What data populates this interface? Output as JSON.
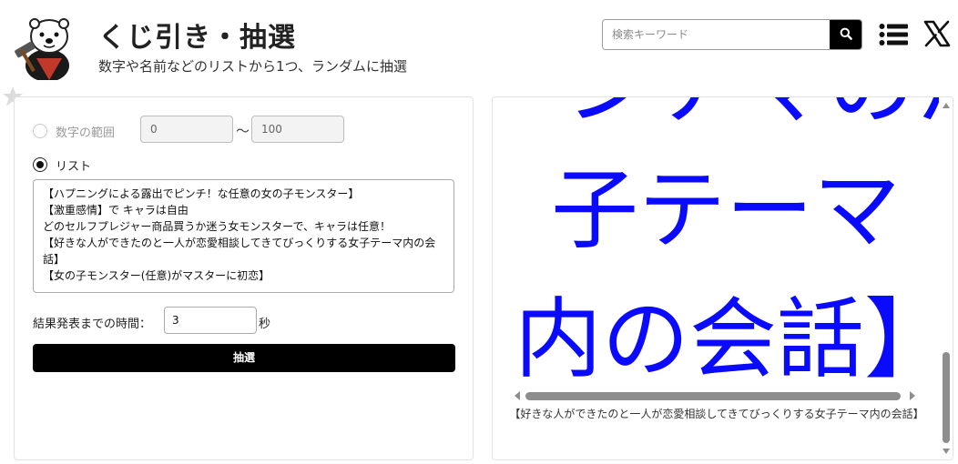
{
  "header": {
    "title": "くじ引き・抽選",
    "subtitle": "数字や名前などのリストから1つ、ランダムに抽選",
    "search": {
      "placeholder": "検索キーワード",
      "value": ""
    }
  },
  "form": {
    "range_option": {
      "label": "数字の範囲",
      "min_placeholder": "0",
      "tilde": "〜",
      "max_placeholder": "100",
      "selected": false,
      "disabled": true
    },
    "list_option": {
      "label": "リスト",
      "selected": true
    },
    "list_lines": [
      "【ハプニングによる露出でピンチ！な任意の女の子モンスター】",
      "【激重感情】で キャラは自由",
      "どのセルフプレジャー商品買うか迷う女モンスターで、キャラは任意！",
      "【好きな人ができたのと一人が恋愛相談してきてびっくりする女子テーマ内の会話】",
      "【女の子モンスター(任意)がマスターに初恋】"
    ],
    "time_label": "結果発表までの時間：",
    "time_value": "3",
    "time_unit": "秒",
    "draw_button": "抽選"
  },
  "result": {
    "big_lines": [
      "ンナマのか",
      "子テーマ",
      "内の会話】"
    ],
    "caption": "【好きな人ができたのと一人が恋愛相談してきてびっくりする女子テーマ内の会話】"
  },
  "colors": {
    "result_text": "#0a0aff",
    "button_bg": "#000000",
    "button_text": "#ffffff"
  },
  "icons": {
    "search": "search-icon",
    "menu": "list-menu-icon",
    "x": "x-logo-icon",
    "star": "star-icon",
    "logo": "otter-logo"
  }
}
